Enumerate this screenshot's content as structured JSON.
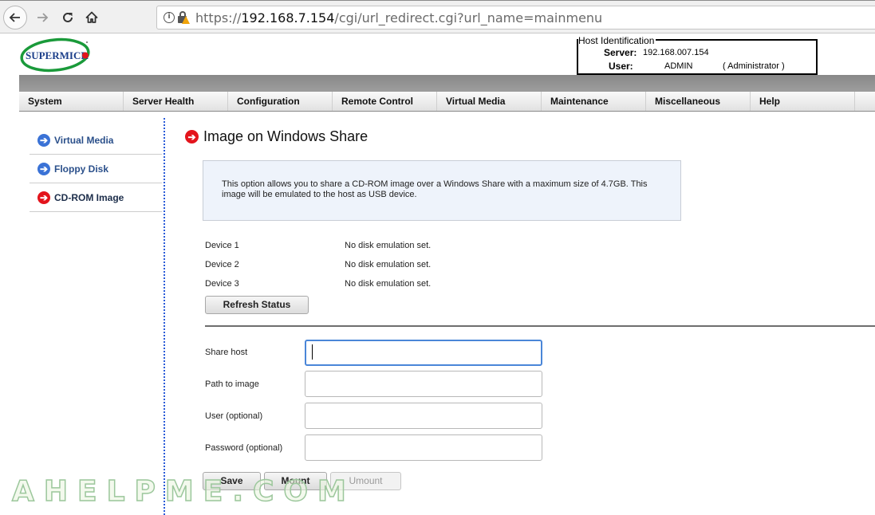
{
  "browser": {
    "url_scheme": "https://",
    "url_host": "192.168.7.154",
    "url_path": "/cgi/url_redirect.cgi?url_name=mainmenu"
  },
  "header": {
    "logo_text": "SUPERMICR",
    "host_identification": {
      "legend": "Host Identification",
      "server_label": "Server:",
      "server_value": "192.168.007.154",
      "user_label": "User:",
      "user_value": "ADMIN",
      "user_role": "( Administrator )"
    }
  },
  "menu": {
    "items": [
      {
        "label": "System"
      },
      {
        "label": "Server Health"
      },
      {
        "label": "Configuration"
      },
      {
        "label": "Remote Control"
      },
      {
        "label": "Virtual Media"
      },
      {
        "label": "Maintenance"
      },
      {
        "label": "Miscellaneous"
      },
      {
        "label": "Help"
      }
    ]
  },
  "sidebar": {
    "items": [
      {
        "label": "Virtual Media",
        "active": false
      },
      {
        "label": "Floppy Disk",
        "active": false
      },
      {
        "label": "CD-ROM Image",
        "active": true
      }
    ]
  },
  "main": {
    "title": "Image on Windows Share",
    "info": "This option allows you to share a CD-ROM image over a Windows Share with a maximum size of 4.7GB. This image will be emulated to the host as USB device.",
    "devices": [
      {
        "name": "Device 1",
        "status": "No disk emulation set."
      },
      {
        "name": "Device 2",
        "status": "No disk emulation set."
      },
      {
        "name": "Device 3",
        "status": "No disk emulation set."
      }
    ],
    "refresh_label": "Refresh Status",
    "form": {
      "share_host_label": "Share host",
      "share_host_value": "",
      "path_label": "Path to image",
      "path_value": "",
      "user_label": "User (optional)",
      "user_value": "",
      "password_label": "Password (optional)",
      "password_value": ""
    },
    "buttons": {
      "save": "Save",
      "mount": "Mount",
      "umount": "Umount"
    }
  },
  "watermark": "AHELPME.COM",
  "colors": {
    "accent_blue": "#3a72d6",
    "accent_red": "#e3141c",
    "focus_border": "#4a86d8"
  }
}
